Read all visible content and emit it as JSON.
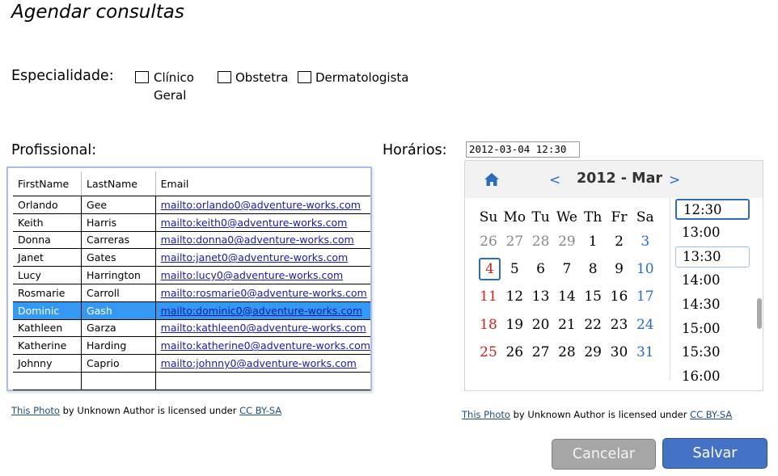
{
  "title": "Agendar consultas",
  "specialty": {
    "label": "Especialidade:",
    "options": [
      {
        "line1": "Clínico",
        "line2": "Geral"
      },
      {
        "line1": "Obstetra"
      },
      {
        "line1": "Dermatologista"
      }
    ]
  },
  "professional": {
    "label": "Profissional:",
    "columns": [
      "FirstName",
      "LastName",
      "Email"
    ],
    "rows": [
      [
        "Orlando",
        "Gee",
        "mailto:orlando0@adventure-works.com"
      ],
      [
        "Keith",
        "Harris",
        "mailto:keith0@adventure-works.com"
      ],
      [
        "Donna",
        "Carreras",
        "mailto:donna0@adventure-works.com"
      ],
      [
        "Janet",
        "Gates",
        "mailto:janet0@adventure-works.com"
      ],
      [
        "Lucy",
        "Harrington",
        "mailto:lucy0@adventure-works.com"
      ],
      [
        "Rosmarie",
        "Carroll",
        "mailto:rosmarie0@adventure-works.com"
      ],
      [
        "Dominic",
        "Gash",
        "mailto:dominic0@adventure-works.com"
      ],
      [
        "Kathleen",
        "Garza",
        "mailto:kathleen0@adventure-works.com"
      ],
      [
        "Katherine",
        "Harding",
        "mailto:katherine0@adventure-works.com"
      ],
      [
        "Johnny",
        "Caprio",
        "mailto:johnny0@adventure-works.com"
      ],
      [
        "",
        "",
        ""
      ]
    ],
    "selected_row": 6
  },
  "credit": {
    "link": "This Photo",
    "middle": " by Unknown Author is licensed under ",
    "license": "CC BY-SA"
  },
  "schedule": {
    "label": "Horários:",
    "input_value": "2012-03-04 12:30",
    "calendar": {
      "month_label": "2012 - Mar",
      "prev": "<",
      "next": ">",
      "weekdays": [
        "Su",
        "Mo",
        "Tu",
        "We",
        "Th",
        "Fr",
        "Sa"
      ],
      "weeks": [
        [
          "26",
          "27",
          "28",
          "29",
          "1",
          "2",
          "3"
        ],
        [
          "4",
          "5",
          "6",
          "7",
          "8",
          "9",
          "10"
        ],
        [
          "11",
          "12",
          "13",
          "14",
          "15",
          "16",
          "17"
        ],
        [
          "18",
          "19",
          "20",
          "21",
          "22",
          "23",
          "24"
        ],
        [
          "25",
          "26",
          "27",
          "28",
          "29",
          "30",
          "31"
        ]
      ],
      "selected_day": "4",
      "colors": {
        "accent": "#2a6ebb",
        "weekend": "#c22222",
        "muted": "#888888"
      }
    },
    "times": [
      "12:30",
      "13:00",
      "13:30",
      "14:00",
      "14:30",
      "15:00",
      "15:30",
      "16:00"
    ],
    "selected_time": "12:30",
    "hovered_time": "13:30"
  },
  "buttons": {
    "cancel": "Cancelar",
    "save": "Salvar"
  },
  "colors": {
    "save": "#4472c4",
    "cancel": "#a6a6a6",
    "selected_row": "#3399f3"
  }
}
